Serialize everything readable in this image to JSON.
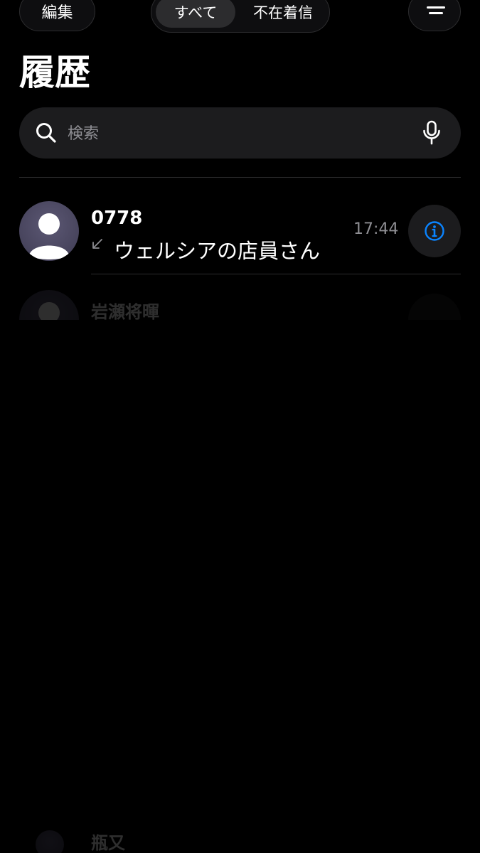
{
  "header": {
    "edit_label": "編集",
    "filter_all_label": "すべて",
    "filter_missed_label": "不在着信",
    "filter_icon": "filter-lines-icon",
    "title": "履歴"
  },
  "search": {
    "placeholder": "検索",
    "search_icon": "magnifier-icon",
    "mic_icon": "microphone-icon"
  },
  "calls": [
    {
      "name": "0778",
      "label": "ウェルシアの店員さん",
      "time": "17:44",
      "direction_icon": "incoming-arrow-icon",
      "info_icon": "info-circle-icon"
    },
    {
      "name": "岩瀬将暉",
      "label": "",
      "time": "",
      "direction_icon": "incoming-arrow-icon",
      "info_icon": "info-circle-icon"
    },
    {
      "name": "瓶又",
      "label": "",
      "time": "",
      "direction_icon": "incoming-arrow-icon",
      "info_icon": "info-circle-icon"
    }
  ],
  "colors": {
    "background": "#000000",
    "accent": "#0a84ff",
    "secondary_text": "#8e8e93",
    "search_fill": "#1c1c1e",
    "avatar_fill": "#4a4660"
  }
}
